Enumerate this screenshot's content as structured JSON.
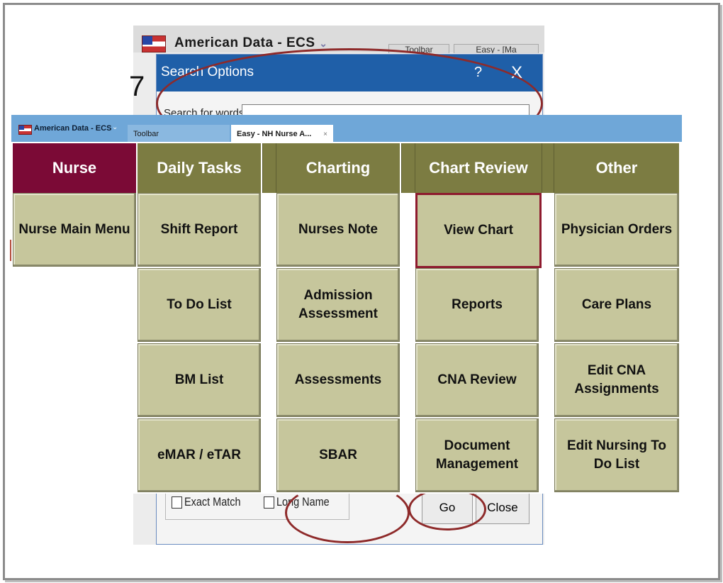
{
  "bg_window": {
    "title": "American Data - ECS",
    "tab1": "Toolbar",
    "tab2": "Easy - [Ma",
    "dialog_title": "Search Options",
    "help_glyph": "?",
    "close_glyph": "X",
    "search_label": "Search for words",
    "search_value": "",
    "exact_match_label": "Exact Match",
    "long_name_label": "Long Name",
    "go_label": "Go",
    "close_label": "Close",
    "step_number": "7"
  },
  "app": {
    "title": "American Data - ECS",
    "tabs": [
      {
        "label": "Toolbar"
      },
      {
        "label": "Easy - NH Nurse A...",
        "close": "×"
      }
    ]
  },
  "menu": {
    "columns": [
      {
        "header": "Nurse",
        "buttons": [
          "Nurse Main Menu"
        ]
      },
      {
        "header": "Daily Tasks",
        "buttons": [
          "Shift Report",
          "To Do List",
          "BM List",
          "eMAR / eTAR"
        ]
      },
      {
        "header": "Charting",
        "buttons": [
          "Nurses Note",
          "Admission Assessment",
          "Assessments",
          "SBAR"
        ]
      },
      {
        "header": "Chart Review",
        "buttons": [
          "View Chart",
          "Reports",
          "CNA Review",
          "Document Management"
        ]
      },
      {
        "header": "Other",
        "buttons": [
          "Physician Orders",
          "Care Plans",
          "Edit CNA Assignments",
          "Edit Nursing To Do List"
        ]
      }
    ],
    "selected": "View Chart"
  },
  "colors": {
    "nurse_header": "#7b0a36",
    "header": "#7c7c42",
    "tile": "#c6c69c",
    "selected_border": "#8e1a2e",
    "tab_bar": "#6fa7d8",
    "dialog_title_bar": "#1f5fa8",
    "annotation_oval": "#8e2a2a"
  }
}
